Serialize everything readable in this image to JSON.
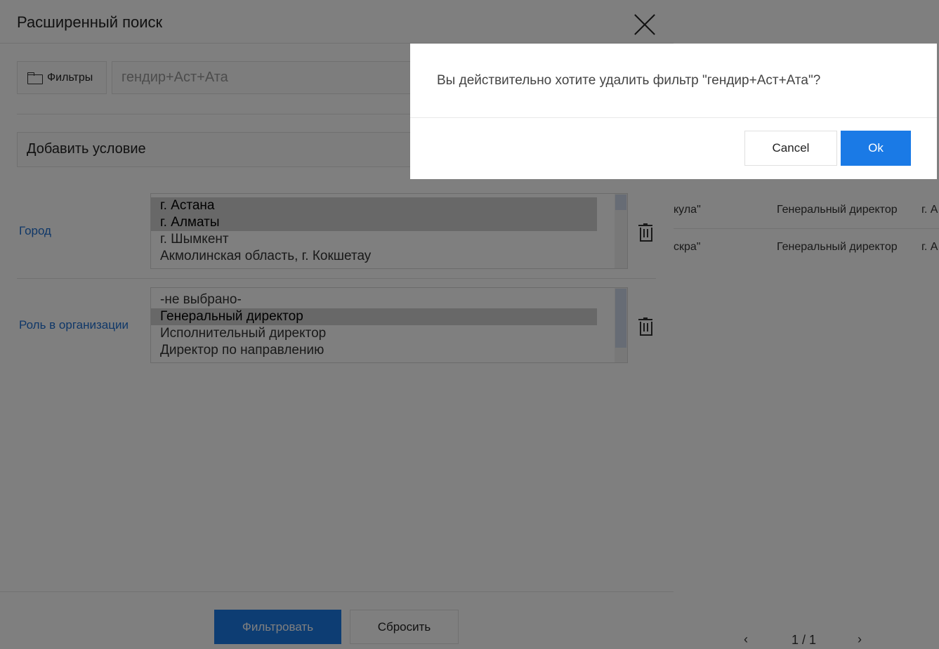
{
  "panel": {
    "title": "Расширенный поиск",
    "filters_button_label": "Фильтры",
    "filter_name_value": "гендир+Аст+Ата",
    "add_condition_label": "Добавить условие",
    "conditions": [
      {
        "label": "Город",
        "options": [
          {
            "text": "г. Астана",
            "selected": true
          },
          {
            "text": "г. Алматы",
            "selected": true
          },
          {
            "text": "г. Шымкент",
            "selected": false
          },
          {
            "text": "Акмолинская область, г. Кокшетау",
            "selected": false
          }
        ]
      },
      {
        "label": "Роль в организации",
        "options": [
          {
            "text": "-не выбрано-",
            "selected": false
          },
          {
            "text": "Генеральный директор",
            "selected": true
          },
          {
            "text": "Исполнительный директор",
            "selected": false
          },
          {
            "text": "Директор по направлению",
            "selected": false
          }
        ]
      }
    ],
    "filter_button_label": "Фильтровать",
    "reset_button_label": "Сбросить"
  },
  "background_table": {
    "rows": [
      {
        "c1": "кула\"",
        "c2": "Генеральный директор",
        "c3": "г. А"
      },
      {
        "c1": "скра\"",
        "c2": "Генеральный директор",
        "c3": "г. А"
      }
    ],
    "pager_label": "1 / 1"
  },
  "dialog": {
    "message": "Вы действительно хотите удалить фильтр \"гендир+Аст+Ата\"?",
    "cancel_label": "Cancel",
    "ok_label": "Ok"
  },
  "colors": {
    "accent": "#1a7ae6",
    "link": "#1f6fd1",
    "overlay": "rgba(0,0,0,0.5)"
  }
}
